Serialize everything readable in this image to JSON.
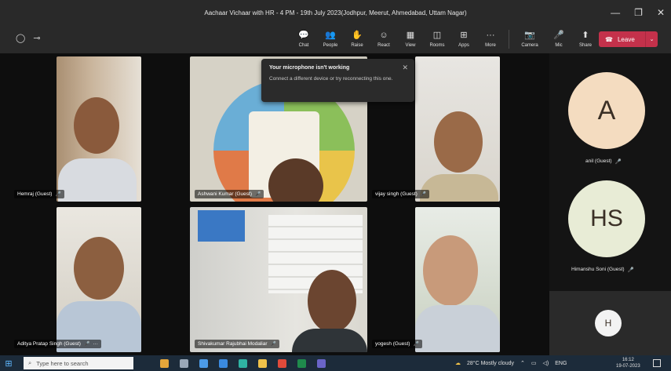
{
  "window": {
    "title": "Aachaar Vichaar with HR - 4 PM - 19th July 2023(Jodhpur, Meerut, Ahmedabad, Uttam Nagar)",
    "minimize": "—",
    "restore": "❐",
    "close": "✕"
  },
  "toolbar": {
    "items": [
      {
        "label": "Chat",
        "icon": "chat-icon",
        "glyph": "💬"
      },
      {
        "label": "People",
        "icon": "people-icon",
        "glyph": "👥"
      },
      {
        "label": "Raise",
        "icon": "raise-hand-icon",
        "glyph": "✋"
      },
      {
        "label": "React",
        "icon": "react-icon",
        "glyph": "☺"
      },
      {
        "label": "View",
        "icon": "view-icon",
        "glyph": "▦"
      },
      {
        "label": "Rooms",
        "icon": "rooms-icon",
        "glyph": "◫"
      },
      {
        "label": "Apps",
        "icon": "apps-icon",
        "glyph": "⊞"
      },
      {
        "label": "More",
        "icon": "more-icon",
        "glyph": "···"
      }
    ],
    "devices": [
      {
        "label": "Camera",
        "icon": "camera-off-icon",
        "glyph": "📷"
      },
      {
        "label": "Mic",
        "icon": "mic-off-icon",
        "glyph": "🎤"
      },
      {
        "label": "Share",
        "icon": "share-icon",
        "glyph": "⬆"
      }
    ],
    "leave_label": "Leave"
  },
  "participants": [
    {
      "name": "Hemraj (Guest)"
    },
    {
      "name": "Ashwani Kumar (Guest)"
    },
    {
      "name": "vijay singh (Guest)"
    },
    {
      "name": "Aditya Pratap Singh (Guest)"
    },
    {
      "name": "Shivakumar Rajubhai Modaliar"
    },
    {
      "name": "yogesh (Guest)"
    }
  ],
  "mic_glyph": "🎤",
  "more_glyph": "···",
  "toast": {
    "title": "Your microphone isn't working",
    "body": "Connect a different device or try reconnecting this one.",
    "close": "✕"
  },
  "side_participants": [
    {
      "initials": "A",
      "name": "anil (Guest)",
      "color": "#f4dcc0"
    },
    {
      "initials": "HS",
      "name": "Himanshu Soni (Guest)",
      "color": "#e8ecd6"
    },
    {
      "initials": "H",
      "name": "",
      "color": "#f3f3f3"
    }
  ],
  "taskbar": {
    "search_placeholder": "Type here to search",
    "weather": "28°C  Mostly cloudy",
    "lang": "ENG",
    "time": "16:12",
    "date": "19-07-2023"
  }
}
